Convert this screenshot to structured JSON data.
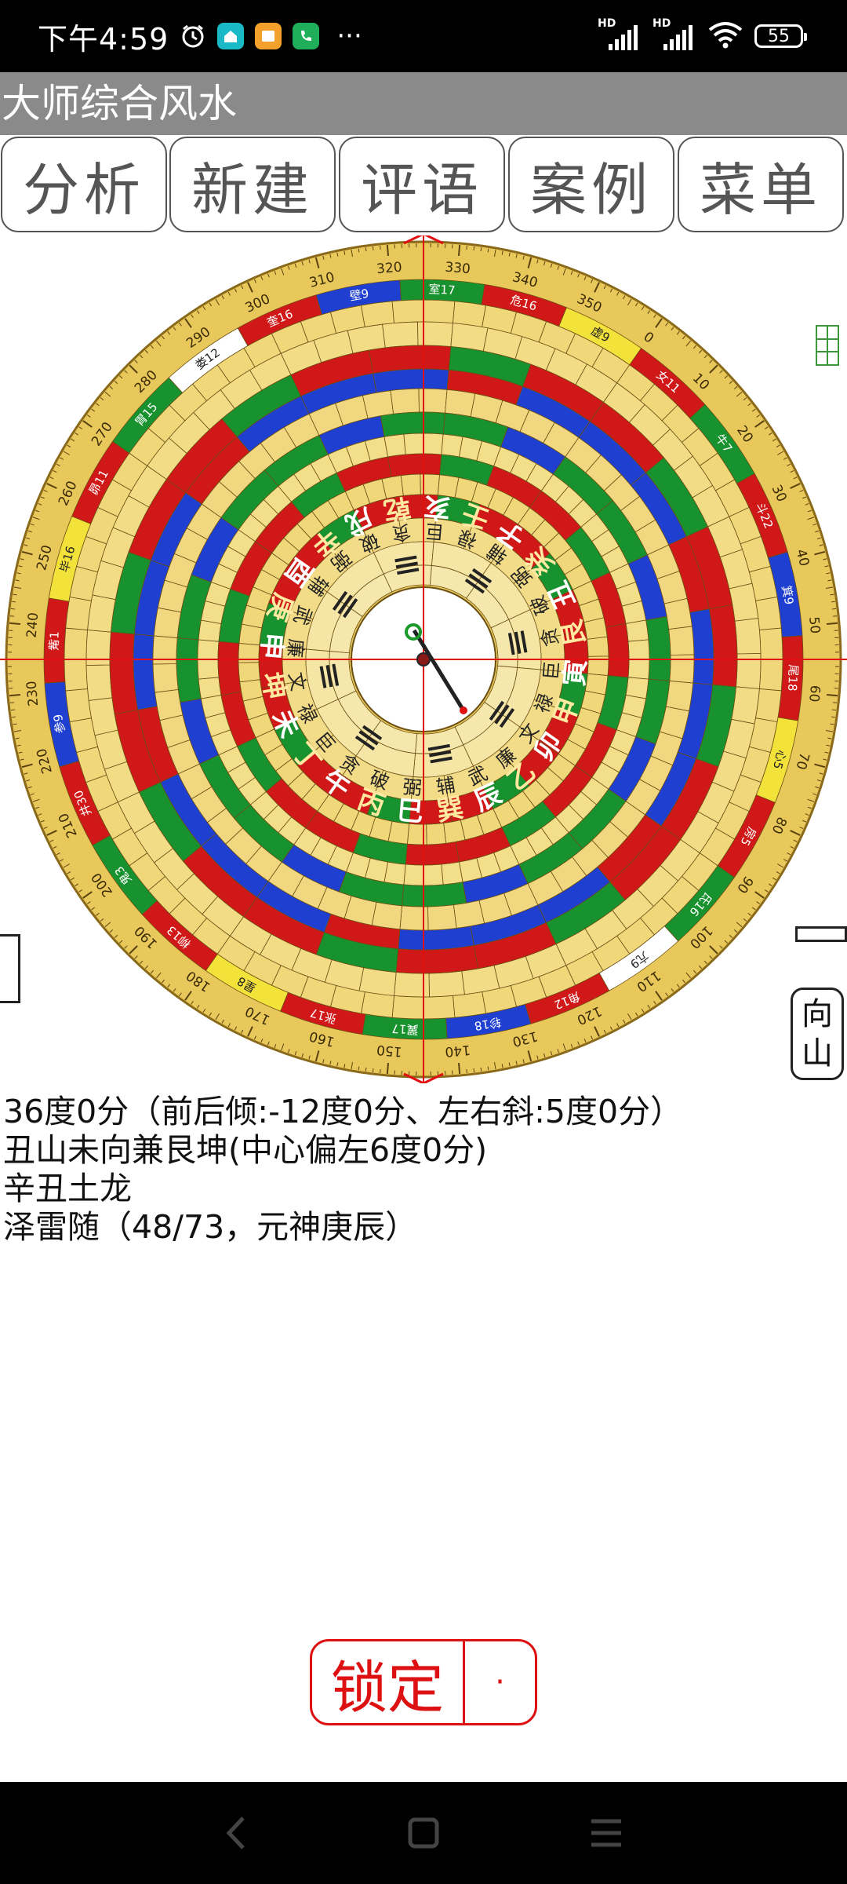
{
  "status": {
    "time": "下午4:59",
    "battery": "55",
    "network_labels": [
      "HD",
      "HD"
    ]
  },
  "app": {
    "title": "大师综合风水"
  },
  "tabs": [
    {
      "label": "分析"
    },
    {
      "label": "新建"
    },
    {
      "label": "评语"
    },
    {
      "label": "案例"
    },
    {
      "label": "菜单"
    }
  ],
  "compass": {
    "degree_ticks": [
      "0",
      "10",
      "20",
      "30",
      "40",
      "50",
      "60",
      "70",
      "80",
      "90",
      "100",
      "110",
      "120",
      "130",
      "140",
      "150",
      "160",
      "170",
      "180",
      "190",
      "200",
      "210",
      "220",
      "230",
      "240",
      "250",
      "260",
      "270",
      "280",
      "290",
      "300",
      "310",
      "320",
      "330",
      "340",
      "350"
    ],
    "mountains": [
      "子",
      "癸",
      "丑",
      "艮",
      "寅",
      "甲",
      "卯",
      "乙",
      "辰",
      "巽",
      "巳",
      "丙",
      "午",
      "丁",
      "未",
      "坤",
      "申",
      "庚",
      "酉",
      "辛",
      "戌",
      "乾",
      "亥",
      "壬"
    ],
    "stars": [
      "辅",
      "弼",
      "破",
      "贪",
      "巨",
      "禄",
      "文",
      "廉",
      "武",
      "辅",
      "弼",
      "破",
      "贪",
      "巨",
      "禄",
      "文",
      "廉",
      "武",
      "辅",
      "弼",
      "破",
      "贪",
      "巨",
      "禄"
    ],
    "constellations": [
      "女11",
      "牛7",
      "斗22",
      "箕9",
      "尾18",
      "心5",
      "房5",
      "氐16",
      "亢9",
      "角12",
      "轸18",
      "翼17",
      "张17",
      "星8",
      "柳13",
      "鬼3",
      "井30",
      "参9",
      "觜1",
      "毕16",
      "昴11",
      "胃15",
      "娄12",
      "奎16",
      "壁9",
      "室17",
      "危16",
      "虚9"
    ]
  },
  "side": {
    "xiang": "向",
    "shan": "山"
  },
  "info": {
    "line1": "36度0分（前后倾:-12度0分、左右斜:5度0分）",
    "line2": "丑山未向兼艮坤(中心偏左6度0分)",
    "line3": "辛丑土龙",
    "line4": "泽雷随（48/73，元神庚辰）"
  },
  "lock": {
    "label": "锁定",
    "dot": "·"
  },
  "colors": {
    "gold": "#e8c85a",
    "red": "#d01818",
    "green": "#18922e",
    "blue": "#1f3fd1",
    "title_gray": "#8a8a8a"
  }
}
